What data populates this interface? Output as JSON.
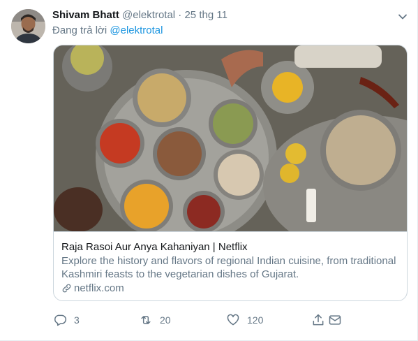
{
  "tweet": {
    "author_name": "Shivam Bhatt",
    "handle": "@elektrotal",
    "separator": "·",
    "date": "25 thg 11",
    "reply_prefix": "Đang trả lời",
    "reply_to": "@elektrotal"
  },
  "card": {
    "title": "Raja Rasoi Aur Anya Kahaniyan | Netflix",
    "description": "Explore the history and flavors of regional Indian cuisine, from traditional Kashmiri feasts to the vegetarian dishes of Gujarat.",
    "domain": "netflix.com"
  },
  "actions": {
    "replies": "3",
    "retweets": "20",
    "likes": "120"
  },
  "icons": [
    "avatar",
    "chevron-down-icon",
    "link-icon",
    "reply-icon",
    "retweet-icon",
    "like-icon",
    "share-icon",
    "dm-icon"
  ],
  "colors": {
    "text": "#14171a",
    "secondary": "#657786",
    "link": "#1b95e0",
    "border": "#ccd6dd"
  }
}
